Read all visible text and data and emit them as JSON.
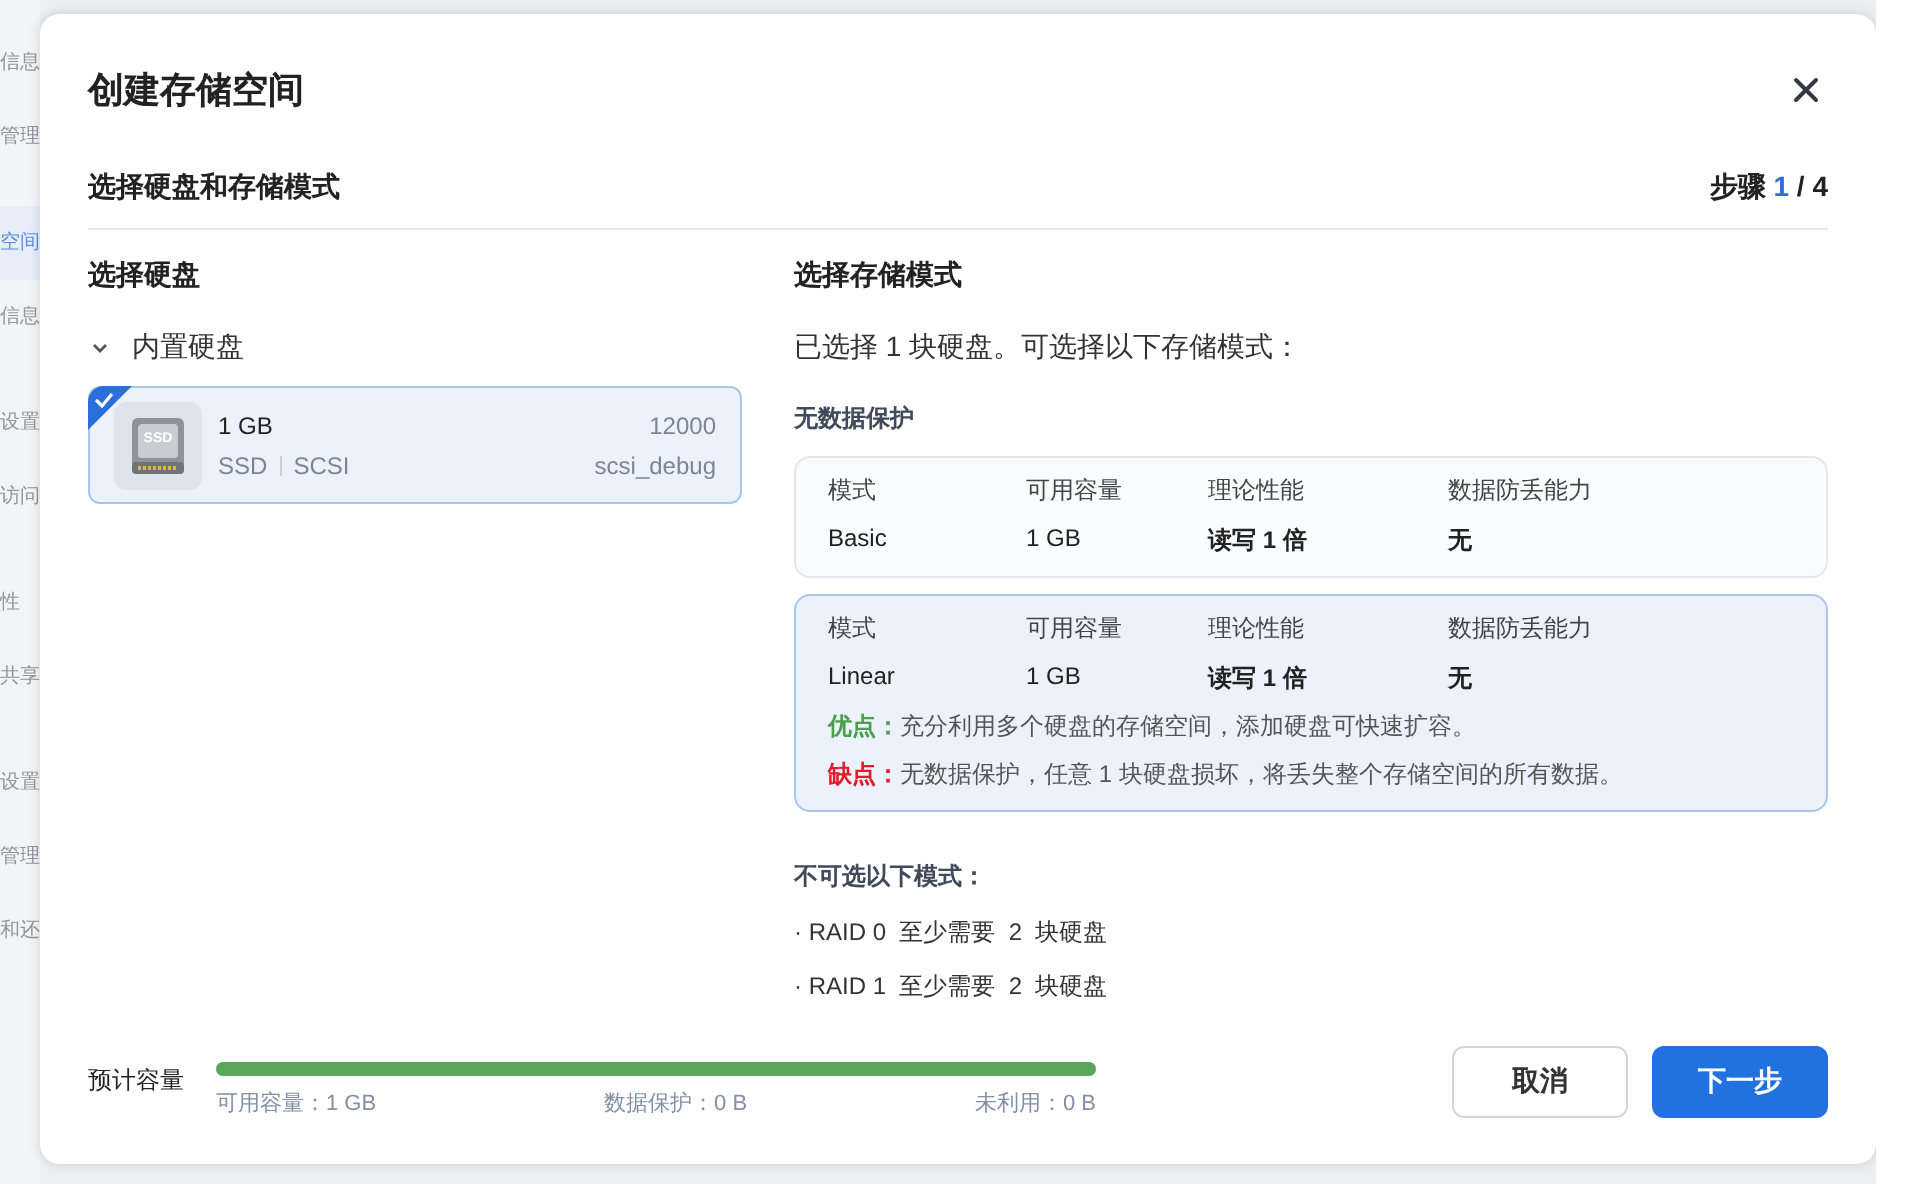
{
  "sidebar": {
    "groups": [
      {
        "items": [
          {
            "label": "信息",
            "selected": false
          },
          {
            "label": "管理",
            "selected": false
          }
        ]
      },
      {
        "items": [
          {
            "label": "空间",
            "selected": true
          },
          {
            "label": "信息",
            "selected": false
          }
        ]
      },
      {
        "items": [
          {
            "label": "设置",
            "selected": false
          },
          {
            "label": "访问",
            "selected": false
          }
        ]
      },
      {
        "items": [
          {
            "label": "性",
            "selected": false
          },
          {
            "label": "共享",
            "selected": false
          }
        ]
      },
      {
        "items": [
          {
            "label": "设置",
            "selected": false
          },
          {
            "label": "管理",
            "selected": false
          },
          {
            "label": "和还",
            "selected": false
          }
        ]
      }
    ]
  },
  "dialog": {
    "title": "创建存储空间",
    "subtitle": "选择硬盘和存储模式",
    "step": {
      "label": "步骤",
      "current": "1",
      "total": "/ 4"
    },
    "disks": {
      "title": "选择硬盘",
      "group": {
        "label": "内置硬盘",
        "expanded": true,
        "items": [
          {
            "badge": "SSD",
            "size": "1 GB",
            "type": "SSD",
            "interface": "SCSI",
            "model": "12000",
            "name": "scsi_debug",
            "checked": true
          }
        ]
      }
    },
    "modes": {
      "title": "选择存储模式",
      "summary": "已选择 1 块硬盘。可选择以下存储模式：",
      "section": "无数据保护",
      "options": [
        {
          "columns": [
            "模式",
            "可用容量",
            "理论性能",
            "数据防丢能力"
          ],
          "values": [
            "Basic",
            "1 GB",
            "读写 1 倍",
            "无"
          ],
          "selected": false
        },
        {
          "columns": [
            "模式",
            "可用容量",
            "理论性能",
            "数据防丢能力"
          ],
          "values": [
            "Linear",
            "1 GB",
            "读写 1 倍",
            "无"
          ],
          "selected": true,
          "pros": {
            "label": "优点：",
            "text": "充分利用多个硬盘的存储空间，添加硬盘可快速扩容。"
          },
          "cons": {
            "label": "缺点：",
            "text": "无数据保护，任意 1 块硬盘损坏，将丢失整个存储空间的所有数据。"
          }
        }
      ],
      "unavailable": {
        "title": "不可选以下模式：",
        "items": [
          "· RAID 0  至少需要  2  块硬盘",
          "· RAID 1  至少需要  2  块硬盘"
        ]
      }
    },
    "estimate": {
      "label": "预计容量",
      "level": 1,
      "legend": [
        "可用容量：1 GB",
        "数据保护：0 B",
        "未利用：0 B"
      ]
    },
    "buttons": [
      {
        "label": "取消",
        "kind": "secondary"
      },
      {
        "label": "下一步",
        "kind": "primary"
      }
    ]
  }
}
